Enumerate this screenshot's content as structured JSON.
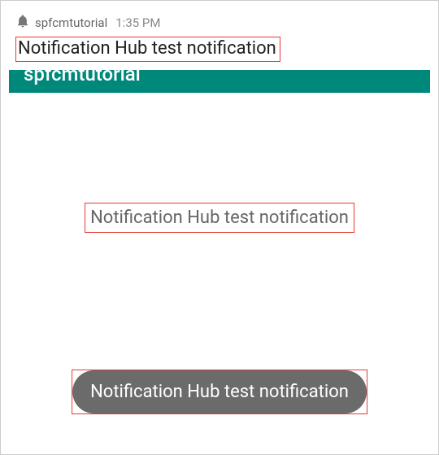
{
  "notification": {
    "app_name": "spfcmtutorial",
    "time": "1:35 PM",
    "title": "Notification Hub test notification"
  },
  "app_bar": {
    "title": "spfcmtutorial"
  },
  "dialog": {
    "message": "Notification Hub test notification"
  },
  "toast": {
    "message": "Notification Hub test notification"
  }
}
